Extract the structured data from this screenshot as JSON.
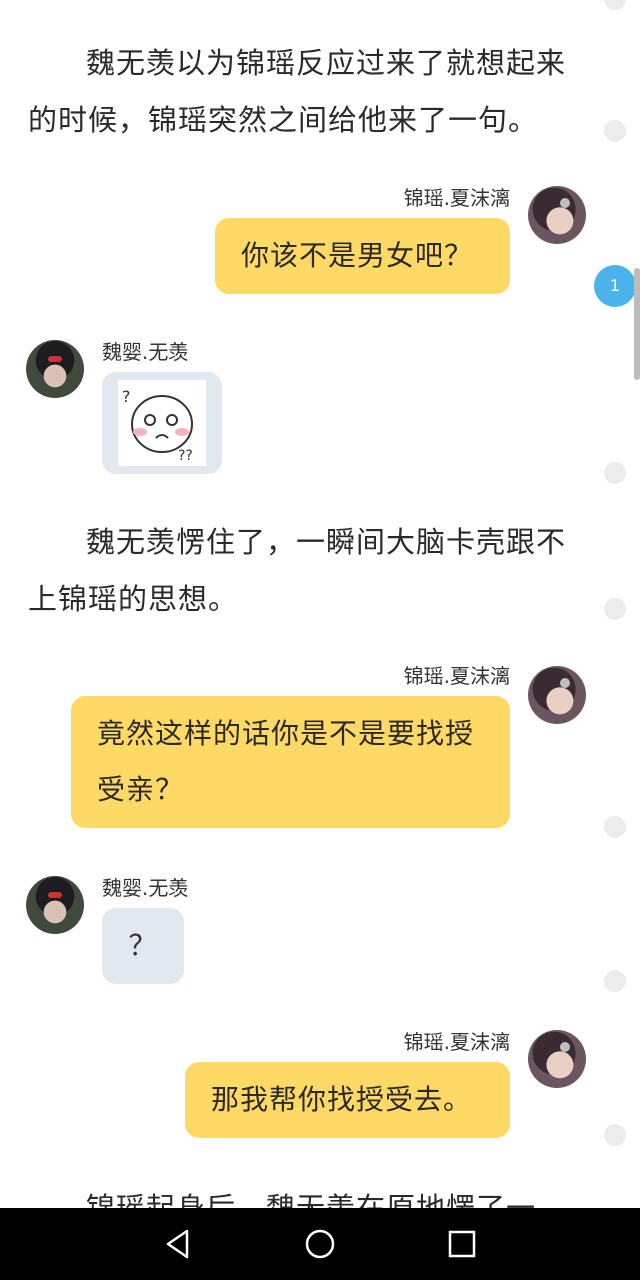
{
  "story": {
    "p1": "魏无羡以为锦瑶反应过来了就想起来的时候，锦瑶突然之间给他来了一句。",
    "p2": "魏无羡愣住了，一瞬间大脑卡壳跟不上锦瑶的思想。",
    "p3": "锦瑶起身后，魏无羡在原地愣了一"
  },
  "messages": {
    "m1_name": "锦瑶.夏沫漓",
    "m1_text": "你该不是男女吧？",
    "m2_name": "魏婴.无羡",
    "m3_name": "锦瑶.夏沫漓",
    "m3_text": "竟然这样的话你是不是要找授受亲？",
    "m4_name": "魏婴.无羡",
    "m4_text": "？",
    "m5_name": "锦瑶.夏沫漓",
    "m5_text": "那我帮你找授受去。"
  },
  "badge": {
    "count": "1"
  },
  "colors": {
    "accent_bubble": "#ffd966",
    "grey_bubble": "#e2e8f0",
    "badge": "#4ab3ea"
  },
  "icons": {
    "sticker": "confused-face-sticker",
    "nav_back": "back-triangle-icon",
    "nav_home": "home-circle-icon",
    "nav_recent": "recent-square-icon"
  }
}
